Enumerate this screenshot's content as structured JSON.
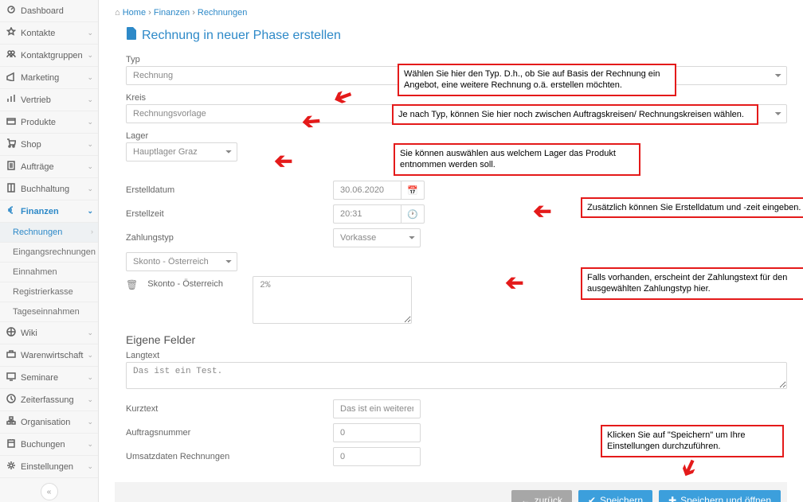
{
  "breadcrumb": {
    "home": "Home",
    "sep": "›",
    "a": "Finanzen",
    "b": "Rechnungen"
  },
  "page_title": "Rechnung in neuer Phase erstellen",
  "sidebar": {
    "items": [
      {
        "label": "Dashboard",
        "icon": "dashboard-icon",
        "chev": false
      },
      {
        "label": "Kontakte",
        "icon": "star-icon",
        "chev": true
      },
      {
        "label": "Kontaktgruppen",
        "icon": "group-icon",
        "chev": true
      },
      {
        "label": "Marketing",
        "icon": "marketing-icon",
        "chev": true
      },
      {
        "label": "Vertrieb",
        "icon": "chart-icon",
        "chev": true
      },
      {
        "label": "Produkte",
        "icon": "box-icon",
        "chev": true
      },
      {
        "label": "Shop",
        "icon": "cart-icon",
        "chev": true
      },
      {
        "label": "Aufträge",
        "icon": "doc-icon",
        "chev": true
      },
      {
        "label": "Buchhaltung",
        "icon": "book-icon",
        "chev": true
      },
      {
        "label": "Finanzen",
        "icon": "euro-icon",
        "chev": true,
        "active": true
      },
      {
        "label": "Wiki",
        "icon": "wiki-icon",
        "chev": true
      },
      {
        "label": "Warenwirtschaft",
        "icon": "ware-icon",
        "chev": true
      },
      {
        "label": "Seminare",
        "icon": "seminar-icon",
        "chev": true
      },
      {
        "label": "Zeiterfassung",
        "icon": "clock-icon",
        "chev": true
      },
      {
        "label": "Organisation",
        "icon": "org-icon",
        "chev": true
      },
      {
        "label": "Buchungen",
        "icon": "booking-icon",
        "chev": true
      },
      {
        "label": "Einstellungen",
        "icon": "gear-icon",
        "chev": true
      }
    ],
    "subitems": [
      {
        "label": "Rechnungen",
        "selected": true
      },
      {
        "label": "Eingangsrechnungen"
      },
      {
        "label": "Einnahmen"
      },
      {
        "label": "Registrierkasse"
      },
      {
        "label": "Tageseinnahmen"
      }
    ]
  },
  "form": {
    "typ_label": "Typ",
    "typ_value": "Rechnung",
    "kreis_label": "Kreis",
    "kreis_value": "Rechnungsvorlage",
    "lager_label": "Lager",
    "lager_value": "Hauptlager Graz",
    "erstelldatum_label": "Erstelldatum",
    "erstelldatum_value": "30.06.2020",
    "erstellzeit_label": "Erstellzeit",
    "erstellzeit_value": "20:31",
    "zahlungstyp_label": "Zahlungstyp",
    "zahlungstyp_value": "Vorkasse",
    "skonto_select": "Skonto - Österreich",
    "skonto_label": "Skonto - Österreich",
    "skonto_text": "2%",
    "eigene_felder": "Eigene Felder",
    "langtext_label": "Langtext",
    "langtext_value": "Das ist ein Test.",
    "kurztext_label": "Kurztext",
    "kurztext_value": "Das ist ein weiterer Test",
    "auftrag_label": "Auftragsnummer",
    "auftrag_value": "0",
    "umsatz_label": "Umsatzdaten Rechnungen",
    "umsatz_value": "0"
  },
  "annotations": {
    "typ": "Wählen Sie hier den Typ. D.h., ob Sie auf Basis der Rechnung ein Angebot, eine weitere Rechnung o.ä. erstellen möchten.",
    "kreis": "Je nach Typ, können Sie hier noch zwischen Auftragskreisen/ Rechnungskreisen wählen.",
    "lager": "Sie können auswählen aus welchem Lager das Produkt entnommen werden soll.",
    "datum": "Zusätzlich können Sie Erstelldatum und -zeit eingeben.",
    "zahlung": "Falls vorhanden, erscheint der Zahlungstext für den ausgewählten Zahlungstyp hier.",
    "speichern": "Klicken Sie auf \"Speichern\" um Ihre Einstellungen durchzuführen."
  },
  "buttons": {
    "back": "zurück",
    "save": "Speichern",
    "save_open": "Speichern und öffnen"
  }
}
